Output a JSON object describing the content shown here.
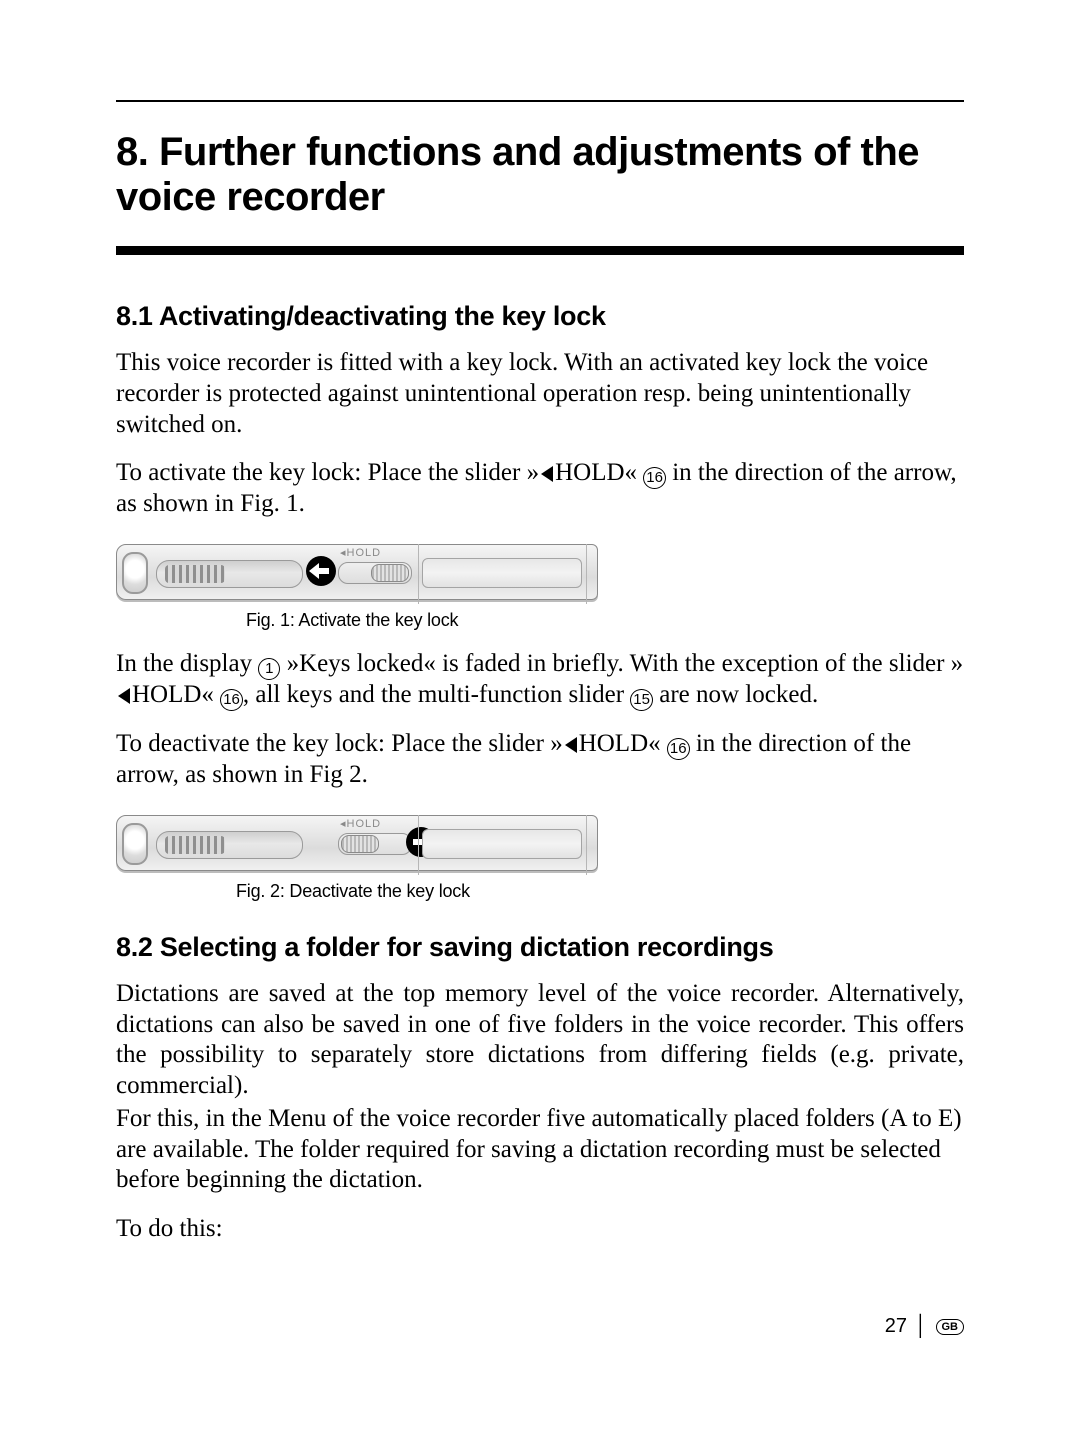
{
  "chapter_title": "8. Further functions and adjustments of the voice recorder",
  "section_81_title": "8.1 Activating/deactivating the key lock",
  "p1": "This voice recorder is fitted with a key lock. With an activated key lock the voice recorder is protected against unintentional operation resp. being unintentionally switched on.",
  "p2a": "To activate the key lock: Place the slider »",
  "p2b": "HOLD« ",
  "p2c": " in the direction of the arrow, as shown in Fig. 1.",
  "fig1_caption": "Fig. 1: Activate the key lock",
  "p3a": "In the display ",
  "p3b": " »Keys locked« is faded in briefly. With the exception of the slider »",
  "p3c": "HOLD« ",
  "p3d": ", all keys and the multi-function slider ",
  "p3e": " are now locked.",
  "p4a": "To deactivate the key lock: Place the slider »",
  "p4b": "HOLD« ",
  "p4c": " in the direction of the arrow, as shown in Fig 2.",
  "fig2_caption": "Fig. 2: Deactivate the key lock",
  "section_82_title": "8.2 Selecting a folder for saving dictation recordings",
  "p5": "Dictations are saved at the top memory level of the voice recorder. Alternatively, dictations can also be saved in one of five folders in the voice recorder. This offers the possibility to separately store dictations from differing fields (e.g. private, commercial).",
  "p6": "For this, in the Menu of the voice recorder five automatically placed folders (A to E) are available. The folder required for saving a dictation recording must be selected before beginning the dictation.",
  "p7": "To do this:",
  "callout_1": "1",
  "callout_15": "15",
  "callout_16": "16",
  "hold_label": "◂HOLD",
  "page_number": "27",
  "lang": "GB"
}
